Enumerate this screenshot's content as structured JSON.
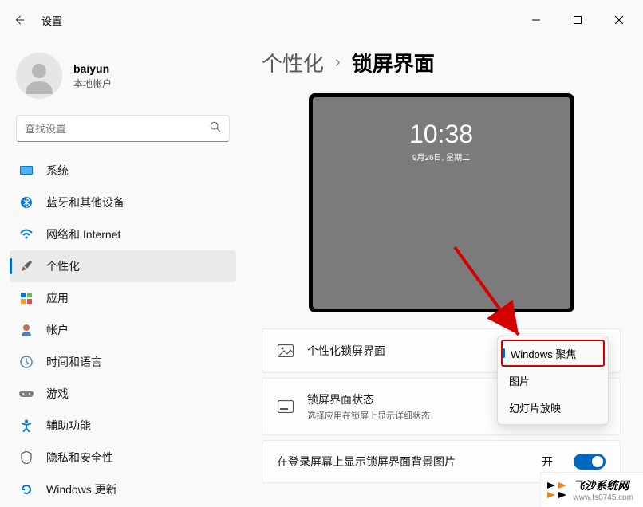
{
  "titlebar": {
    "title": "设置"
  },
  "user": {
    "name": "baiyun",
    "type": "本地帐户"
  },
  "search": {
    "placeholder": "查找设置"
  },
  "nav": {
    "items": [
      {
        "label": "系统"
      },
      {
        "label": "蓝牙和其他设备"
      },
      {
        "label": "网络和 Internet"
      },
      {
        "label": "个性化"
      },
      {
        "label": "应用"
      },
      {
        "label": "帐户"
      },
      {
        "label": "时间和语言"
      },
      {
        "label": "游戏"
      },
      {
        "label": "辅助功能"
      },
      {
        "label": "隐私和安全性"
      },
      {
        "label": "Windows 更新"
      }
    ]
  },
  "breadcrumb": {
    "parent": "个性化",
    "sep": "›",
    "current": "锁屏界面"
  },
  "preview": {
    "time": "10:38",
    "date": "9月26日, 星期二"
  },
  "cards": {
    "personalize": {
      "title": "个性化锁屏界面"
    },
    "status": {
      "title": "锁屏界面状态",
      "sub": "选择应用在锁屏上显示详细状态"
    },
    "show_bg": {
      "title": "在登录屏幕上显示锁屏界面背景图片",
      "toggle_label": "开"
    }
  },
  "dropdown": {
    "options": [
      {
        "label": "Windows 聚焦"
      },
      {
        "label": "图片"
      },
      {
        "label": "幻灯片放映"
      }
    ]
  },
  "watermark": {
    "title": "飞沙系统网",
    "url": "www.fs0745.com"
  }
}
